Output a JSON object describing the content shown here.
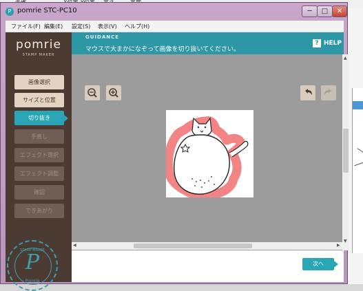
{
  "desktop": {
    "top_labels": [
      "未確",
      "X位置",
      "Y位置",
      "高さ",
      "高度"
    ]
  },
  "window": {
    "title": "pomrie STC-PC10",
    "icon": "pomrie-app-icon",
    "controls": {
      "minimize": "─",
      "maximize": "□",
      "close": "✕"
    }
  },
  "menu": {
    "items": [
      "ファイル(F)",
      "編集(E)",
      "設定(S)",
      "表示(V)",
      "ヘルプ(H)"
    ]
  },
  "sidebar": {
    "logo": "pomrie",
    "logo_sub": "STAMP MAKER",
    "steps": [
      {
        "label": "画像選択",
        "state": "active"
      },
      {
        "label": "サイズと位置",
        "state": "active"
      },
      {
        "label": "切り抜き",
        "state": "current"
      },
      {
        "label": "手直し",
        "state": "disabled"
      },
      {
        "label": "エフェクト選択",
        "state": "disabled"
      },
      {
        "label": "エフェクト調整",
        "state": "disabled"
      },
      {
        "label": "確認",
        "state": "disabled"
      },
      {
        "label": "できあがり",
        "state": "disabled"
      }
    ],
    "stamp": {
      "top": "STAMP MAKER",
      "letter": "P",
      "bottom": "Pomrie"
    }
  },
  "guidance": {
    "label": "GUIDANCE",
    "text": "マウスで大まかになぞって画像を切り抜いてください。",
    "help_icon": "?",
    "help_label": "HELP"
  },
  "toolbar": {
    "zoom_out_icon": "zoom-out-icon",
    "zoom_in_icon": "zoom-in-icon",
    "undo_icon": "undo-icon",
    "redo_icon": "redo-icon"
  },
  "footer": {
    "next_label": "次へ"
  },
  "colors": {
    "accent": "#2aa5b6",
    "sidebar_bg": "#4c3b33",
    "canvas_bg": "#9c9c9c",
    "selection": "#f06e6e"
  }
}
